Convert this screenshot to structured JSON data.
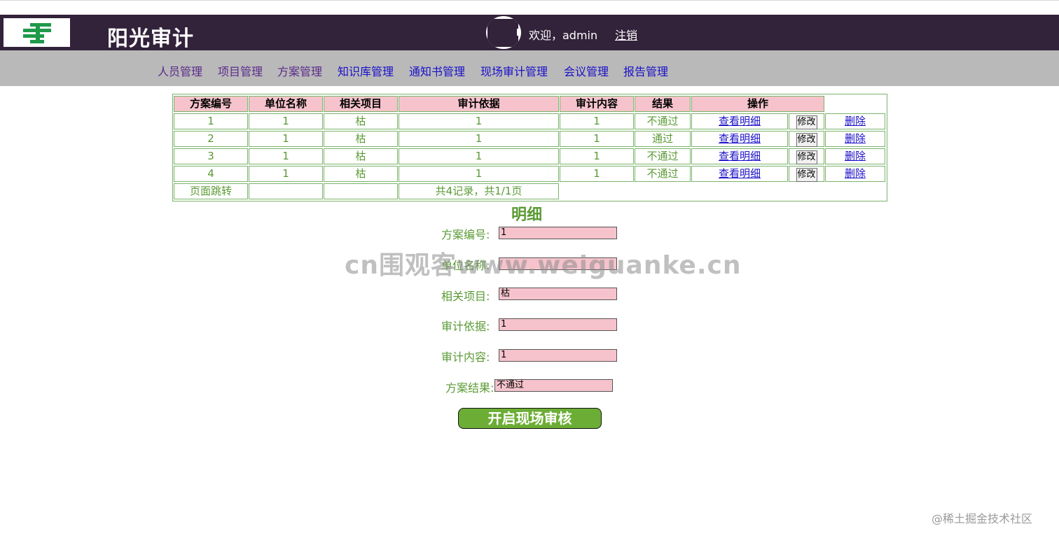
{
  "header": {
    "site_title": "阳光审计",
    "welcome": "欢迎，admin",
    "logout": "注销",
    "logo_icon": "postal-logo-icon"
  },
  "nav": {
    "items": [
      "人员管理",
      "项目管理",
      "方案管理",
      "知识库管理",
      "通知书管理",
      "现场审计管理",
      "会议管理",
      "报告管理"
    ]
  },
  "table": {
    "headers": [
      "方案编号",
      "单位名称",
      "相关项目",
      "审计依据",
      "审计内容",
      "结果",
      "操作"
    ],
    "rows": [
      {
        "id": "1",
        "unit": "1",
        "project": "枯",
        "basis": "1",
        "content": "1",
        "result": "不通过"
      },
      {
        "id": "2",
        "unit": "1",
        "project": "枯",
        "basis": "1",
        "content": "1",
        "result": "通过"
      },
      {
        "id": "3",
        "unit": "1",
        "project": "枯",
        "basis": "1",
        "content": "1",
        "result": "不通过"
      },
      {
        "id": "4",
        "unit": "1",
        "project": "枯",
        "basis": "1",
        "content": "1",
        "result": "不通过"
      }
    ],
    "view_label": "查看明细",
    "edit_label": "修改",
    "delete_label": "删除",
    "footer_jump": "页面跳转",
    "footer_summary": "共4记录，共1/1页"
  },
  "detail": {
    "title": "明细",
    "fields": [
      {
        "label": "方案编号:",
        "value": "1"
      },
      {
        "label": "单位名称:",
        "value": ""
      },
      {
        "label": "相关项目:",
        "value": "枯"
      },
      {
        "label": "审计依据:",
        "value": "1"
      },
      {
        "label": "审计内容:",
        "value": "1"
      },
      {
        "label": "方案结果:",
        "value": "不通过"
      }
    ],
    "start_button": "开启现场审核"
  },
  "watermark": "cn围观客www.weiguanke.cn",
  "footer_mark": "@稀土掘金技术社区",
  "colors": {
    "header_bg": "#32223a",
    "nav_bg": "#b9b9b9",
    "table_header_bg": "#f6c3cc",
    "text_green": "#5a9a34",
    "button_green": "#6cad35"
  }
}
